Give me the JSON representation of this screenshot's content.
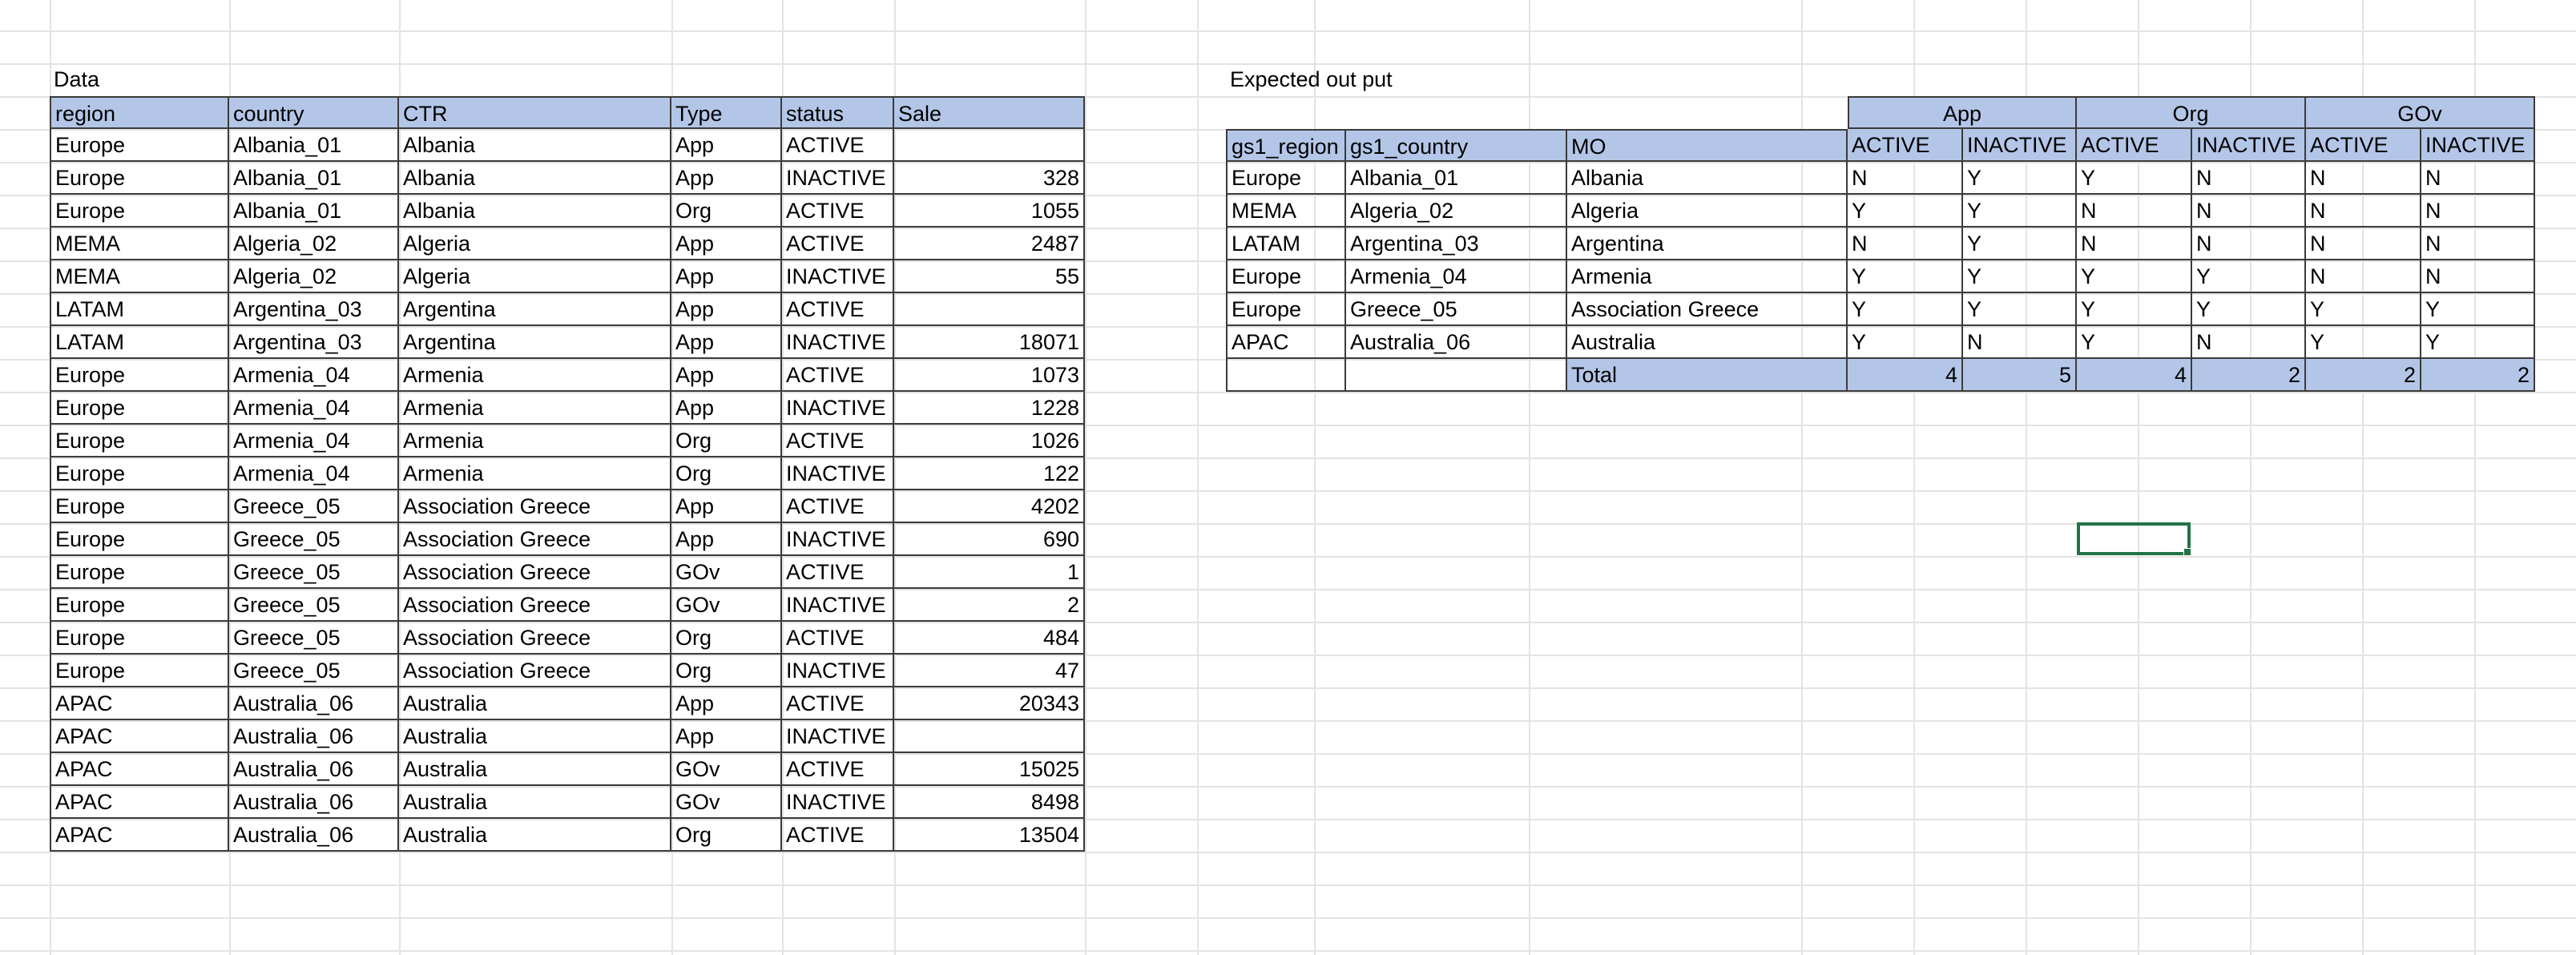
{
  "left_table": {
    "label": "Data",
    "headers": [
      "region",
      "country",
      "CTR",
      "Type",
      "status",
      "Sale"
    ],
    "rows": [
      [
        "Europe",
        "Albania_01",
        "Albania",
        "App",
        "ACTIVE",
        ""
      ],
      [
        "Europe",
        "Albania_01",
        "Albania",
        "App",
        "INACTIVE",
        "328"
      ],
      [
        "Europe",
        "Albania_01",
        "Albania",
        "Org",
        "ACTIVE",
        "1055"
      ],
      [
        "MEMA",
        "Algeria_02",
        "Algeria",
        "App",
        "ACTIVE",
        "2487"
      ],
      [
        "MEMA",
        "Algeria_02",
        "Algeria",
        "App",
        "INACTIVE",
        "55"
      ],
      [
        "LATAM",
        "Argentina_03",
        "Argentina",
        "App",
        "ACTIVE",
        ""
      ],
      [
        "LATAM",
        "Argentina_03",
        "Argentina",
        "App",
        "INACTIVE",
        "18071"
      ],
      [
        "Europe",
        "Armenia_04",
        "Armenia",
        "App",
        "ACTIVE",
        "1073"
      ],
      [
        "Europe",
        "Armenia_04",
        "Armenia",
        "App",
        "INACTIVE",
        "1228"
      ],
      [
        "Europe",
        "Armenia_04",
        "Armenia",
        "Org",
        "ACTIVE",
        "1026"
      ],
      [
        "Europe",
        "Armenia_04",
        "Armenia",
        "Org",
        "INACTIVE",
        "122"
      ],
      [
        "Europe",
        "Greece_05",
        "Association Greece",
        "App",
        "ACTIVE",
        "4202"
      ],
      [
        "Europe",
        "Greece_05",
        "Association Greece",
        "App",
        "INACTIVE",
        "690"
      ],
      [
        "Europe",
        "Greece_05",
        "Association Greece",
        "GOv",
        "ACTIVE",
        "1"
      ],
      [
        "Europe",
        "Greece_05",
        "Association Greece",
        "GOv",
        "INACTIVE",
        "2"
      ],
      [
        "Europe",
        "Greece_05",
        "Association Greece",
        "Org",
        "ACTIVE",
        "484"
      ],
      [
        "Europe",
        "Greece_05",
        "Association Greece",
        "Org",
        "INACTIVE",
        "47"
      ],
      [
        "APAC",
        "Australia_06",
        "Australia",
        "App",
        "ACTIVE",
        "20343"
      ],
      [
        "APAC",
        "Australia_06",
        "Australia",
        "App",
        "INACTIVE",
        ""
      ],
      [
        "APAC",
        "Australia_06",
        "Australia",
        "GOv",
        "ACTIVE",
        "15025"
      ],
      [
        "APAC",
        "Australia_06",
        "Australia",
        "GOv",
        "INACTIVE",
        "8498"
      ],
      [
        "APAC",
        "Australia_06",
        "Australia",
        "Org",
        "ACTIVE",
        "13504"
      ]
    ]
  },
  "right_table": {
    "label": "Expected out put",
    "groups": [
      "App",
      "Org",
      "GOv"
    ],
    "headers": [
      "gs1_region",
      "gs1_country",
      "MO",
      "ACTIVE",
      "INACTIVE",
      "ACTIVE",
      "INACTIVE",
      "ACTIVE",
      "INACTIVE"
    ],
    "rows": [
      [
        "Europe",
        "Albania_01",
        "Albania",
        "N",
        "Y",
        "Y",
        "N",
        "N",
        "N"
      ],
      [
        "MEMA",
        "Algeria_02",
        "Algeria",
        "Y",
        "Y",
        "N",
        "N",
        "N",
        "N"
      ],
      [
        "LATAM",
        "Argentina_03",
        "Argentina",
        "N",
        "Y",
        "N",
        "N",
        "N",
        "N"
      ],
      [
        "Europe",
        "Armenia_04",
        "Armenia",
        "Y",
        "Y",
        "Y",
        "Y",
        "N",
        "N"
      ],
      [
        "Europe",
        "Greece_05",
        "Association Greece",
        "Y",
        "Y",
        "Y",
        "Y",
        "Y",
        "Y"
      ],
      [
        "APAC",
        "Australia_06",
        "Australia",
        "Y",
        "N",
        "Y",
        "N",
        "Y",
        "Y"
      ]
    ],
    "total_label": "Total",
    "totals": [
      "4",
      "5",
      "4",
      "2",
      "2",
      "2"
    ]
  },
  "colors": {
    "header_fill": "#b4c6e7",
    "gridline": "#e3e3e3",
    "border": "#3b3b3b",
    "selection": "#217346"
  }
}
